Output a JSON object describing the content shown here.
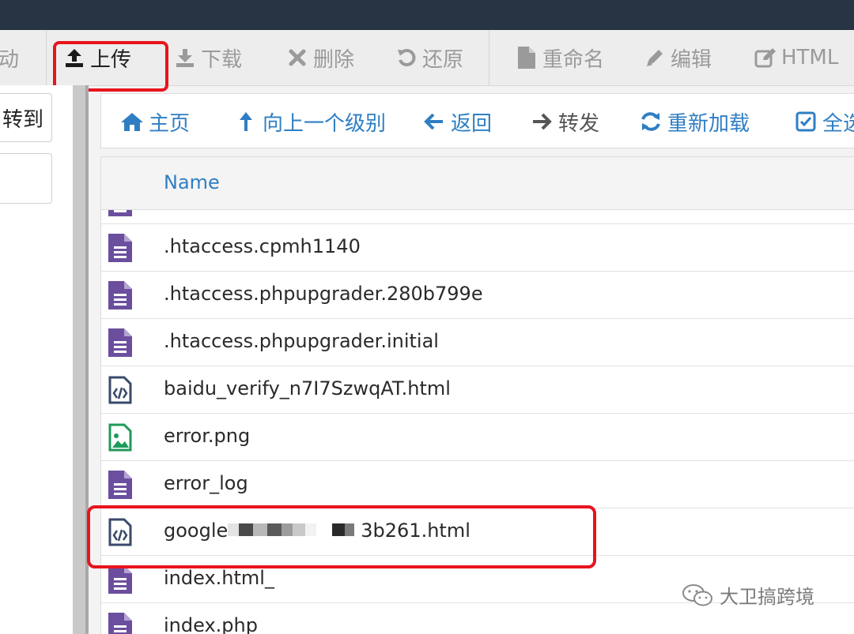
{
  "toolbar": {
    "items": [
      {
        "label": "动",
        "icon": "partial-icon"
      },
      {
        "label": "上传",
        "icon": "upload-icon"
      },
      {
        "label": "下载",
        "icon": "download-icon"
      },
      {
        "label": "删除",
        "icon": "close-icon"
      },
      {
        "label": "还原",
        "icon": "undo-icon"
      },
      {
        "label": "重命名",
        "icon": "file-icon"
      },
      {
        "label": "编辑",
        "icon": "pencil-icon"
      },
      {
        "label": "HTML",
        "icon": "edit-box-icon"
      }
    ]
  },
  "left": {
    "button_label": "转到"
  },
  "nav": {
    "items": [
      {
        "label": "主页",
        "icon": "home-icon"
      },
      {
        "label": "向上一个级别",
        "icon": "arrow-up-icon"
      },
      {
        "label": "返回",
        "icon": "arrow-left-icon"
      },
      {
        "label": "转发",
        "icon": "arrow-right-icon"
      },
      {
        "label": "重新加载",
        "icon": "reload-icon"
      },
      {
        "label": "全选",
        "icon": "checkbox-icon"
      }
    ]
  },
  "files": {
    "column_name": "Name",
    "rows": [
      {
        "name": ".htaccess.cpmh1140",
        "type": "text"
      },
      {
        "name": ".htaccess.phpupgrader.280b799e",
        "type": "text"
      },
      {
        "name": ".htaccess.phpupgrader.initial",
        "type": "text"
      },
      {
        "name": "baidu_verify_n7I7SzwqAT.html",
        "type": "html"
      },
      {
        "name": "error.png",
        "type": "image"
      },
      {
        "name": "error_log",
        "type": "text"
      },
      {
        "name_prefix": "google",
        "name_suffix": "3b261.html",
        "type": "html"
      },
      {
        "name": "index.html_",
        "type": "text"
      },
      {
        "name": "index.php",
        "type": "text"
      }
    ]
  },
  "watermark": {
    "text": "大卫搞跨境"
  },
  "colors": {
    "topbar": "#263444",
    "accent_blue": "#2f7ec3",
    "highlight_red": "#e8141c",
    "text_file_purple": "#6b4f9e",
    "image_file_green": "#1f9a5a",
    "html_file_navy": "#3a4a6b"
  }
}
